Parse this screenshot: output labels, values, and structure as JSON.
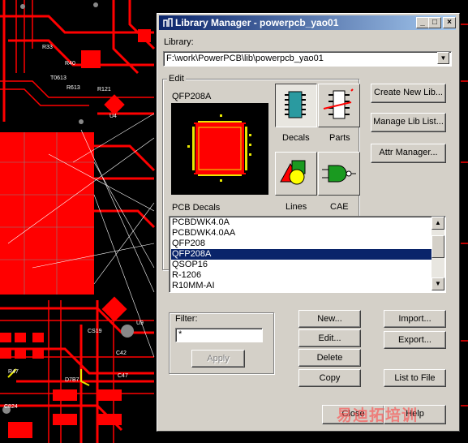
{
  "window": {
    "title": "Library Manager - powerpcb_yao01"
  },
  "titlebar_buttons": {
    "minimize": "_",
    "maximize": "□",
    "close": "×"
  },
  "library": {
    "label": "Library:",
    "value": "F:\\work\\PowerPCB\\lib\\powerpcb_yao01"
  },
  "edit": {
    "group_label": "Edit",
    "preview_title": "QFP208A",
    "type_buttons": {
      "decals": "Decals",
      "parts": "Parts",
      "lines": "Lines",
      "cae": "CAE"
    }
  },
  "right_buttons": {
    "create_new_lib": "Create New Lib...",
    "manage_lib_list": "Manage Lib List...",
    "attr_manager": "Attr Manager..."
  },
  "list": {
    "label": "PCB Decals",
    "items": [
      "PCBDWK4.0A",
      "PCBDWK4.0AA",
      "QFP208",
      "QFP208A",
      "QSOP16",
      "R-1206",
      "R10MM-AI"
    ],
    "selected": "QFP208A"
  },
  "filter": {
    "label": "Filter:",
    "value": "*",
    "apply": "Apply"
  },
  "action_buttons": {
    "new": "New...",
    "edit": "Edit...",
    "delete": "Delete",
    "copy": "Copy",
    "import": "Import...",
    "export": "Export...",
    "list_to_file": "List to File"
  },
  "footer": {
    "close": "Close",
    "help": "Help"
  },
  "watermark": "易迪拓培训",
  "pcb_labels": [
    "R33",
    "R40",
    "T0613",
    "R613",
    "R121",
    "U4",
    "CS19",
    "C42",
    "C47",
    "R47",
    "D7B7",
    "U9",
    "C824"
  ],
  "colors": {
    "title_start": "#0a246a",
    "title_end": "#a6caf0",
    "dialog_bg": "#d4d0c8",
    "selection": "#0a246a",
    "pcb_red": "#ff0000",
    "pcb_pad": "#e8e800"
  }
}
